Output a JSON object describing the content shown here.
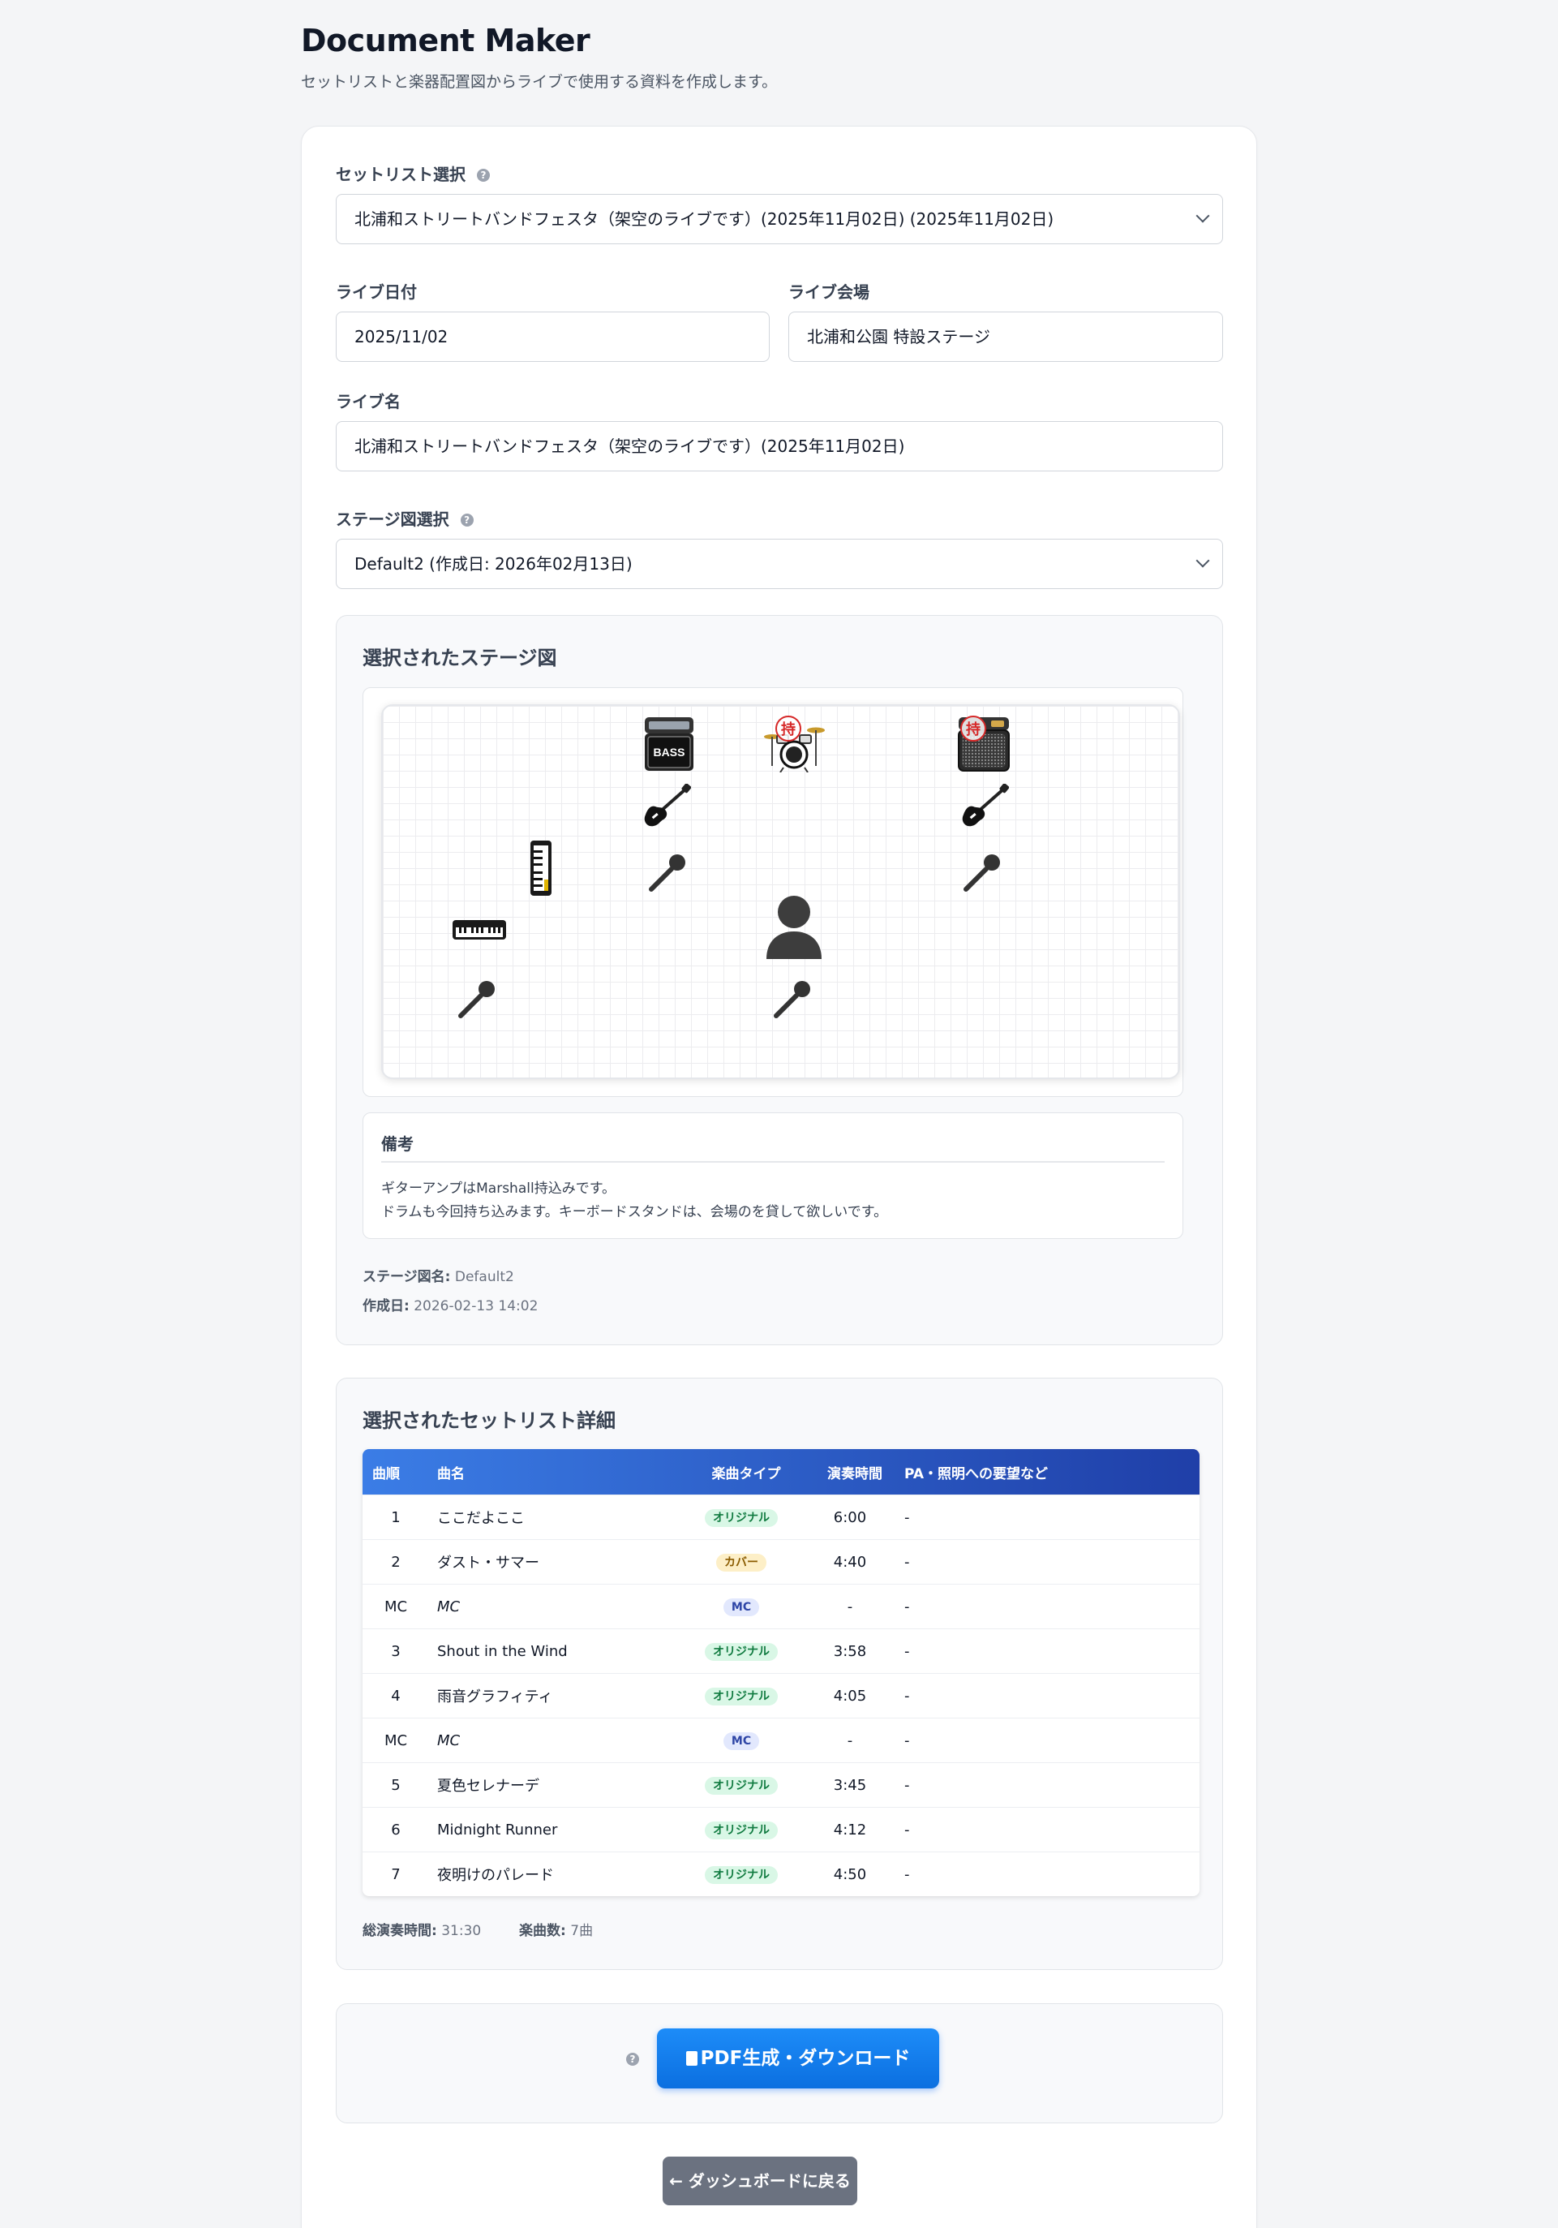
{
  "header": {
    "title": "Document Maker",
    "subtitle": "セットリストと楽器配置図からライブで使用する資料を作成します。"
  },
  "form": {
    "setlist_label": "セットリスト選択",
    "setlist_value": "北浦和ストリートバンドフェスタ（架空のライブです）(2025年11月02日) (2025年11月02日)",
    "date_label": "ライブ日付",
    "date_value": "2025/11/02",
    "venue_label": "ライブ会場",
    "venue_value": "北浦和公園 特設ステージ",
    "name_label": "ライブ名",
    "name_value": "北浦和ストリートバンドフェスタ（架空のライブです）(2025年11月02日)",
    "stage_label": "ステージ図選択",
    "stage_value": "Default2 (作成日: 2026年02月13日)"
  },
  "stage": {
    "title": "選択されたステージ図",
    "bass_amp_text": "BASS",
    "own_mark": "持",
    "notes_title": "備考",
    "notes_lines": [
      "ギターアンプはMarshall持込みです。",
      "ドラムも今回持ち込みます。キーボードスタンドは、会場のを貸して欲しいです。"
    ],
    "meta_name_label": "ステージ図名:",
    "meta_name_value": "Default2",
    "meta_date_label": "作成日:",
    "meta_date_value": "2026-02-13 14:02"
  },
  "setlist": {
    "title": "選択されたセットリスト詳細",
    "columns": [
      "曲順",
      "曲名",
      "楽曲タイプ",
      "演奏時間",
      "PA・照明への要望など"
    ],
    "rows": [
      {
        "no": "1",
        "title": "ここだよここ",
        "type": "オリジナル",
        "time": "6:00",
        "pa": "-"
      },
      {
        "no": "2",
        "title": "ダスト・サマー",
        "type": "カバー",
        "time": "4:40",
        "pa": "-"
      },
      {
        "no": "MC",
        "title": "MC",
        "type": "MC",
        "time": "-",
        "pa": "-"
      },
      {
        "no": "3",
        "title": "Shout in the Wind",
        "type": "オリジナル",
        "time": "3:58",
        "pa": "-"
      },
      {
        "no": "4",
        "title": "雨音グラフィティ",
        "type": "オリジナル",
        "time": "4:05",
        "pa": "-"
      },
      {
        "no": "MC",
        "title": "MC",
        "type": "MC",
        "time": "-",
        "pa": "-"
      },
      {
        "no": "5",
        "title": "夏色セレナーデ",
        "type": "オリジナル",
        "time": "3:45",
        "pa": "-"
      },
      {
        "no": "6",
        "title": "Midnight Runner",
        "type": "オリジナル",
        "time": "4:12",
        "pa": "-"
      },
      {
        "no": "7",
        "title": "夜明けのパレード",
        "type": "オリジナル",
        "time": "4:50",
        "pa": "-"
      }
    ],
    "total_label": "総演奏時間:",
    "total_value": "31:30",
    "count_label": "楽曲数:",
    "count_value": "7曲"
  },
  "actions": {
    "pdf_button": "PDF生成・ダウンロード",
    "back_button": "← ダッシュボードに戻る"
  }
}
